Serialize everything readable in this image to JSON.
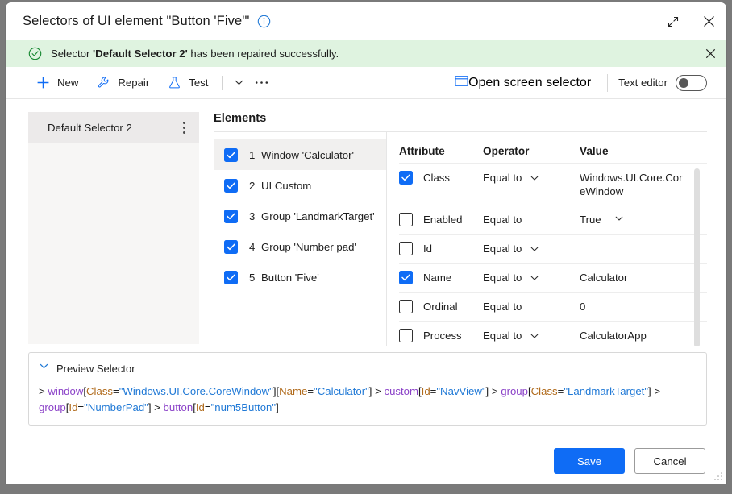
{
  "window": {
    "title": "Selectors of UI element \"Button 'Five'\"",
    "info_icon": "info-icon",
    "expand_icon": "expand-diagonal-icon",
    "close_icon": "close-icon"
  },
  "banner": {
    "icon": "check-circle-icon",
    "text_before": "Selector ",
    "text_bold": "'Default Selector 2'",
    "text_after": " has been repaired successfully.",
    "close_icon": "close-icon",
    "background": "#dff3e0",
    "accent": "#1a8a34"
  },
  "toolbar": {
    "new_label": "New",
    "new_icon": "plus-icon",
    "repair_label": "Repair",
    "repair_icon": "wrench-icon",
    "test_label": "Test",
    "test_icon": "flask-icon",
    "chevron_icon": "chevron-down-icon",
    "overflow_icon": "ellipsis-icon",
    "open_screen_selector_label": "Open screen selector",
    "open_screen_selector_icon": "window-frame-icon",
    "text_editor_label": "Text editor",
    "text_editor_on": false,
    "accent": "#0f6cf5"
  },
  "selectors_panel": {
    "items": [
      {
        "name": "Default Selector 2",
        "selected": true,
        "menu_icon": "kebab-menu-icon"
      }
    ]
  },
  "elements": {
    "heading": "Elements",
    "rows": [
      {
        "index": "1",
        "label": "Window 'Calculator'",
        "checked": true,
        "selected": true
      },
      {
        "index": "2",
        "label": "UI Custom",
        "checked": true,
        "selected": false
      },
      {
        "index": "3",
        "label": "Group 'LandmarkTarget'",
        "checked": true,
        "selected": false
      },
      {
        "index": "4",
        "label": "Group 'Number pad'",
        "checked": true,
        "selected": false
      },
      {
        "index": "5",
        "label": "Button 'Five'",
        "checked": true,
        "selected": false
      }
    ]
  },
  "attributes": {
    "headers": {
      "attribute": "Attribute",
      "operator": "Operator",
      "value": "Value"
    },
    "rows": [
      {
        "checked": true,
        "name": "Class",
        "operator": "Equal to",
        "operator_dropdown": true,
        "value": "Windows.UI.Core.CoreWindow",
        "value_dropdown": false
      },
      {
        "checked": false,
        "name": "Enabled",
        "operator": "Equal to",
        "operator_dropdown": false,
        "value": "True",
        "value_dropdown": true
      },
      {
        "checked": false,
        "name": "Id",
        "operator": "Equal to",
        "operator_dropdown": true,
        "value": "",
        "value_dropdown": false
      },
      {
        "checked": true,
        "name": "Name",
        "operator": "Equal to",
        "operator_dropdown": true,
        "value": "Calculator",
        "value_dropdown": false
      },
      {
        "checked": false,
        "name": "Ordinal",
        "operator": "Equal to",
        "operator_dropdown": false,
        "value": "0",
        "value_dropdown": false
      },
      {
        "checked": false,
        "name": "Process",
        "operator": "Equal to",
        "operator_dropdown": true,
        "value": "CalculatorApp",
        "value_dropdown": false
      }
    ]
  },
  "preview": {
    "heading": "Preview Selector",
    "chevron_icon": "chevron-down-icon",
    "tokens": [
      {
        "t": "gt",
        "v": "> "
      },
      {
        "t": "tag",
        "v": "window"
      },
      {
        "t": "br",
        "v": "["
      },
      {
        "t": "attr",
        "v": "Class"
      },
      {
        "t": "br",
        "v": "="
      },
      {
        "t": "str",
        "v": "\"Windows.UI.Core.CoreWindow\""
      },
      {
        "t": "br",
        "v": "]["
      },
      {
        "t": "attr",
        "v": "Name"
      },
      {
        "t": "br",
        "v": "="
      },
      {
        "t": "str",
        "v": "\"Calculator\""
      },
      {
        "t": "br",
        "v": "] "
      },
      {
        "t": "gt",
        "v": "> "
      },
      {
        "t": "tag",
        "v": "custom"
      },
      {
        "t": "br",
        "v": "["
      },
      {
        "t": "attr",
        "v": "Id"
      },
      {
        "t": "br",
        "v": "="
      },
      {
        "t": "str",
        "v": "\"NavView\""
      },
      {
        "t": "br",
        "v": "] "
      },
      {
        "t": "gt",
        "v": "> "
      },
      {
        "t": "tag",
        "v": "group"
      },
      {
        "t": "br",
        "v": "["
      },
      {
        "t": "attr",
        "v": "Class"
      },
      {
        "t": "br",
        "v": "="
      },
      {
        "t": "str",
        "v": "\"LandmarkTarget\""
      },
      {
        "t": "br",
        "v": "] "
      },
      {
        "t": "gt",
        "v": "> "
      },
      {
        "t": "tag",
        "v": "group"
      },
      {
        "t": "br",
        "v": "["
      },
      {
        "t": "attr",
        "v": "Id"
      },
      {
        "t": "br",
        "v": "="
      },
      {
        "t": "str",
        "v": "\"NumberPad\""
      },
      {
        "t": "br",
        "v": "] "
      },
      {
        "t": "gt",
        "v": "> "
      },
      {
        "t": "tag",
        "v": "button"
      },
      {
        "t": "br",
        "v": "["
      },
      {
        "t": "attr",
        "v": "Id"
      },
      {
        "t": "br",
        "v": "="
      },
      {
        "t": "str",
        "v": "\"num5Button\""
      },
      {
        "t": "br",
        "v": "]"
      }
    ]
  },
  "footer": {
    "save_label": "Save",
    "cancel_label": "Cancel"
  }
}
